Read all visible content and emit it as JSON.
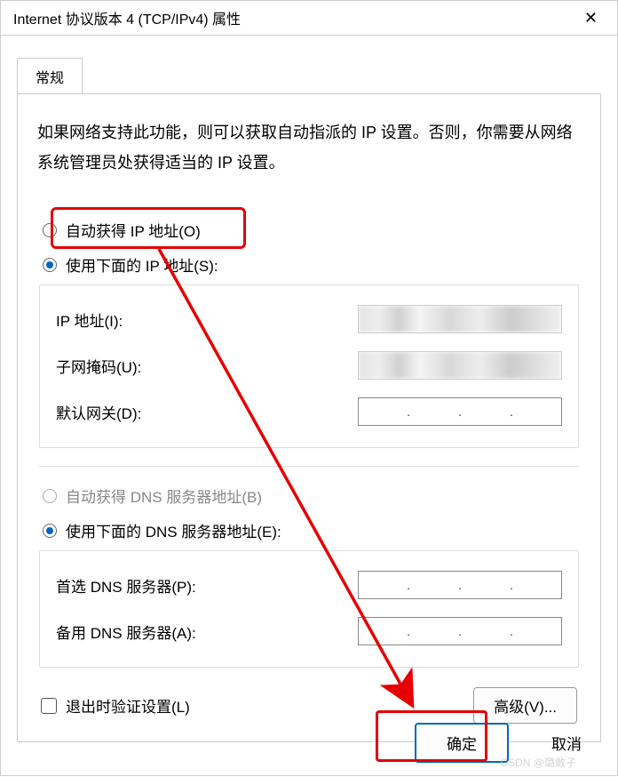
{
  "window": {
    "title": "Internet 协议版本 4 (TCP/IPv4) 属性",
    "close_icon_title": "关闭"
  },
  "tab": {
    "label": "常规"
  },
  "description": "如果网络支持此功能，则可以获取自动指派的 IP 设置。否则，你需要从网络系统管理员处获得适当的 IP 设置。",
  "ip_section": {
    "auto_label": "自动获得 IP 地址(O)",
    "manual_label": "使用下面的 IP 地址(S):",
    "selected": "manual",
    "fields": {
      "ip_label": "IP 地址(I):",
      "ip_value": "",
      "mask_label": "子网掩码(U):",
      "mask_value": "",
      "gateway_label": "默认网关(D):",
      "gateway_value": ""
    }
  },
  "dns_section": {
    "auto_label": "自动获得 DNS 服务器地址(B)",
    "auto_enabled": false,
    "manual_label": "使用下面的 DNS 服务器地址(E):",
    "selected": "manual",
    "fields": {
      "primary_label": "首选 DNS 服务器(P):",
      "primary_value": "",
      "secondary_label": "备用 DNS 服务器(A):",
      "secondary_value": ""
    }
  },
  "validate_label": "退出时验证设置(L)",
  "validate_checked": false,
  "advanced_label": "高级(V)...",
  "buttons": {
    "ok": "确定",
    "cancel": "取消"
  },
  "watermark": "CSDN @璐敢子"
}
